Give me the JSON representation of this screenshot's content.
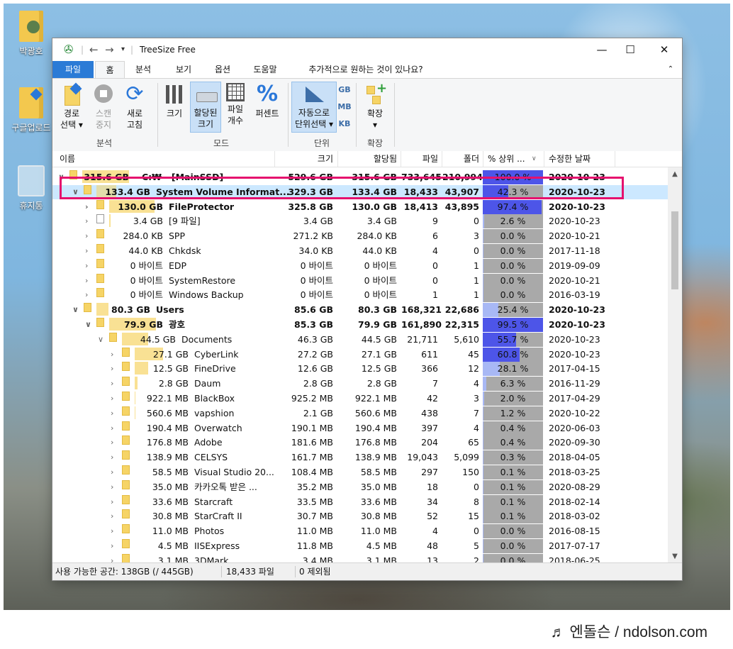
{
  "desktop": {
    "icons": [
      {
        "label": "박광호",
        "icon": "user-folder-icon"
      },
      {
        "label": "구글업로드",
        "icon": "shared-folder-icon"
      },
      {
        "label": "휴지통",
        "icon": "recycle-bin-icon"
      }
    ],
    "watermark": "♬ 엔돌슨 / ndolson.com"
  },
  "window": {
    "title": "TreeSize Free",
    "controls": {
      "minimize": "—",
      "maximize": "☐",
      "close": "✕"
    }
  },
  "menu": {
    "tabs": [
      "파일",
      "홈",
      "분석",
      "보기",
      "옵션",
      "도움말"
    ],
    "tell_me": "추가적으로 원하는 것이 있나요?"
  },
  "ribbon": {
    "buttons": {
      "path_select": "경로\n선택 ▾",
      "scan_stop": "스캔\n중지",
      "refresh": "새로\n고침",
      "size": "크기",
      "allocated_size": "할당된\n크기",
      "file_count": "파일\n개수",
      "percent": "퍼센트",
      "auto_unit": "자동으로\n단위선택 ▾",
      "unit_gb": "GB",
      "unit_mb": "MB",
      "unit_kb": "KB",
      "expand": "확장\n▾"
    },
    "groups": {
      "analysis": "분석",
      "mode": "모드",
      "unit": "단위",
      "expand": "확장"
    }
  },
  "columns": [
    "이름",
    "크기",
    "할당됨",
    "파일",
    "폴더",
    "% 상위 ...",
    "수정한 날짜"
  ],
  "rows": [
    {
      "alloc_label": "315.6 GB",
      "name": "C:₩ - [MainSSD]",
      "size": "529.6 GB",
      "allocated": "315.6 GB",
      "files": "733,645",
      "folders": "210,994",
      "pct": "100.0 %",
      "pct_value": 100.0,
      "date": "2020-10-23",
      "depth": 0,
      "expanded": true,
      "bold": true,
      "drive": true
    },
    {
      "alloc_label": "133.4 GB",
      "name": "System Volume Informat...",
      "size": "329.3 GB",
      "allocated": "133.4 GB",
      "files": "18,433",
      "folders": "43,907",
      "pct": "42.3 %",
      "pct_value": 42.3,
      "date": "2020-10-23",
      "depth": 1,
      "expanded": true,
      "bold": true,
      "highlight": true
    },
    {
      "alloc_label": "130.0 GB",
      "name": "FileProtector",
      "size": "325.8 GB",
      "allocated": "130.0 GB",
      "files": "18,413",
      "folders": "43,895",
      "pct": "97.4 %",
      "pct_value": 97.4,
      "date": "2020-10-23",
      "depth": 2,
      "expanded": false,
      "bold": true
    },
    {
      "alloc_label": "3.4 GB",
      "name": "[9 파일]",
      "size": "3.4 GB",
      "allocated": "3.4 GB",
      "files": "9",
      "folders": "0",
      "pct": "2.6 %",
      "pct_value": 2.6,
      "date": "2020-10-23",
      "depth": 2,
      "expanded": false,
      "file": true
    },
    {
      "alloc_label": "284.0 KB",
      "name": "SPP",
      "size": "271.2 KB",
      "allocated": "284.0 KB",
      "files": "6",
      "folders": "3",
      "pct": "0.0 %",
      "pct_value": 0.0,
      "date": "2020-10-21",
      "depth": 2,
      "expanded": false
    },
    {
      "alloc_label": "44.0 KB",
      "name": "Chkdsk",
      "size": "34.0 KB",
      "allocated": "44.0 KB",
      "files": "4",
      "folders": "0",
      "pct": "0.0 %",
      "pct_value": 0.0,
      "date": "2017-11-18",
      "depth": 2,
      "expanded": false
    },
    {
      "alloc_label": "0 바이트",
      "name": "EDP",
      "size": "0 바이트",
      "allocated": "0 바이트",
      "files": "0",
      "folders": "1",
      "pct": "0.0 %",
      "pct_value": 0.0,
      "date": "2019-09-09",
      "depth": 2,
      "expanded": false
    },
    {
      "alloc_label": "0 바이트",
      "name": "SystemRestore",
      "size": "0 바이트",
      "allocated": "0 바이트",
      "files": "0",
      "folders": "1",
      "pct": "0.0 %",
      "pct_value": 0.0,
      "date": "2020-10-21",
      "depth": 2,
      "expanded": false
    },
    {
      "alloc_label": "0 바이트",
      "name": "Windows Backup",
      "size": "0 바이트",
      "allocated": "0 바이트",
      "files": "1",
      "folders": "1",
      "pct": "0.0 %",
      "pct_value": 0.0,
      "date": "2016-03-19",
      "depth": 2,
      "expanded": false
    },
    {
      "alloc_label": "80.3 GB",
      "name": "Users",
      "size": "85.6 GB",
      "allocated": "80.3 GB",
      "files": "168,321",
      "folders": "22,686",
      "pct": "25.4 %",
      "pct_value": 25.4,
      "date": "2020-10-23",
      "depth": 1,
      "expanded": true,
      "bold": true
    },
    {
      "alloc_label": "79.9 GB",
      "name": "광호",
      "size": "85.3 GB",
      "allocated": "79.9 GB",
      "files": "161,890",
      "folders": "22,315",
      "pct": "99.5 %",
      "pct_value": 99.5,
      "date": "2020-10-23",
      "depth": 2,
      "expanded": true,
      "bold": true
    },
    {
      "alloc_label": "44.5 GB",
      "name": "Documents",
      "size": "46.3 GB",
      "allocated": "44.5 GB",
      "files": "21,711",
      "folders": "5,610",
      "pct": "55.7 %",
      "pct_value": 55.7,
      "date": "2020-10-23",
      "depth": 3,
      "expanded": true
    },
    {
      "alloc_label": "27.1 GB",
      "name": "CyberLink",
      "size": "27.2 GB",
      "allocated": "27.1 GB",
      "files": "611",
      "folders": "45",
      "pct": "60.8 %",
      "pct_value": 60.8,
      "date": "2020-10-23",
      "depth": 4,
      "expanded": false
    },
    {
      "alloc_label": "12.5 GB",
      "name": "FineDrive",
      "size": "12.6 GB",
      "allocated": "12.5 GB",
      "files": "366",
      "folders": "12",
      "pct": "28.1 %",
      "pct_value": 28.1,
      "date": "2017-04-15",
      "depth": 4,
      "expanded": false
    },
    {
      "alloc_label": "2.8 GB",
      "name": "Daum",
      "size": "2.8 GB",
      "allocated": "2.8 GB",
      "files": "7",
      "folders": "4",
      "pct": "6.3 %",
      "pct_value": 6.3,
      "date": "2016-11-29",
      "depth": 4,
      "expanded": false
    },
    {
      "alloc_label": "922.1 MB",
      "name": "BlackBox",
      "size": "925.2 MB",
      "allocated": "922.1 MB",
      "files": "42",
      "folders": "3",
      "pct": "2.0 %",
      "pct_value": 2.0,
      "date": "2017-04-29",
      "depth": 4,
      "expanded": false
    },
    {
      "alloc_label": "560.6 MB",
      "name": "vapshion",
      "size": "2.1 GB",
      "allocated": "560.6 MB",
      "files": "438",
      "folders": "7",
      "pct": "1.2 %",
      "pct_value": 1.2,
      "date": "2020-10-22",
      "depth": 4,
      "expanded": false
    },
    {
      "alloc_label": "190.4 MB",
      "name": "Overwatch",
      "size": "190.1 MB",
      "allocated": "190.4 MB",
      "files": "397",
      "folders": "4",
      "pct": "0.4 %",
      "pct_value": 0.4,
      "date": "2020-06-03",
      "depth": 4,
      "expanded": false
    },
    {
      "alloc_label": "176.8 MB",
      "name": "Adobe",
      "size": "181.6 MB",
      "allocated": "176.8 MB",
      "files": "204",
      "folders": "65",
      "pct": "0.4 %",
      "pct_value": 0.4,
      "date": "2020-09-30",
      "depth": 4,
      "expanded": false
    },
    {
      "alloc_label": "138.9 MB",
      "name": "CELSYS",
      "size": "161.7 MB",
      "allocated": "138.9 MB",
      "files": "19,043",
      "folders": "5,099",
      "pct": "0.3 %",
      "pct_value": 0.3,
      "date": "2018-04-05",
      "depth": 4,
      "expanded": false
    },
    {
      "alloc_label": "58.5 MB",
      "name": "Visual Studio 20...",
      "size": "108.4 MB",
      "allocated": "58.5 MB",
      "files": "297",
      "folders": "150",
      "pct": "0.1 %",
      "pct_value": 0.1,
      "date": "2018-03-25",
      "depth": 4,
      "expanded": false
    },
    {
      "alloc_label": "35.0 MB",
      "name": "카카오톡 받은 ...",
      "size": "35.2 MB",
      "allocated": "35.0 MB",
      "files": "18",
      "folders": "0",
      "pct": "0.1 %",
      "pct_value": 0.1,
      "date": "2020-08-29",
      "depth": 4,
      "expanded": false
    },
    {
      "alloc_label": "33.6 MB",
      "name": "Starcraft",
      "size": "33.5 MB",
      "allocated": "33.6 MB",
      "files": "34",
      "folders": "8",
      "pct": "0.1 %",
      "pct_value": 0.1,
      "date": "2018-02-14",
      "depth": 4,
      "expanded": false
    },
    {
      "alloc_label": "30.8 MB",
      "name": "StarCraft II",
      "size": "30.7 MB",
      "allocated": "30.8 MB",
      "files": "52",
      "folders": "15",
      "pct": "0.1 %",
      "pct_value": 0.1,
      "date": "2018-03-02",
      "depth": 4,
      "expanded": false
    },
    {
      "alloc_label": "11.0 MB",
      "name": "Photos",
      "size": "11.0 MB",
      "allocated": "11.0 MB",
      "files": "4",
      "folders": "0",
      "pct": "0.0 %",
      "pct_value": 0.0,
      "date": "2016-08-15",
      "depth": 4,
      "expanded": false
    },
    {
      "alloc_label": "4.5 MB",
      "name": "IISExpress",
      "size": "11.8 MB",
      "allocated": "4.5 MB",
      "files": "48",
      "folders": "5",
      "pct": "0.0 %",
      "pct_value": 0.0,
      "date": "2017-07-17",
      "depth": 4,
      "expanded": false
    },
    {
      "alloc_label": "3.1 MB",
      "name": "3DMark",
      "size": "3.4 MB",
      "allocated": "3.1 MB",
      "files": "13",
      "folders": "2",
      "pct": "0.0 %",
      "pct_value": 0.0,
      "date": "2018-06-25",
      "depth": 4,
      "expanded": false
    }
  ],
  "status": {
    "free_space": "사용 가능한 공간: 138GB  (/ 445GB)",
    "files": "18,433 파일",
    "excluded": "0 제외됨"
  },
  "colors": {
    "accent": "#2b7bd6",
    "highlight_row": "#cce8ff",
    "annotation_box": "#e5126e",
    "folder": "#f6d466",
    "pct_bar_high": "#4d55e8",
    "pct_bar_low": "#a8b8f5"
  }
}
